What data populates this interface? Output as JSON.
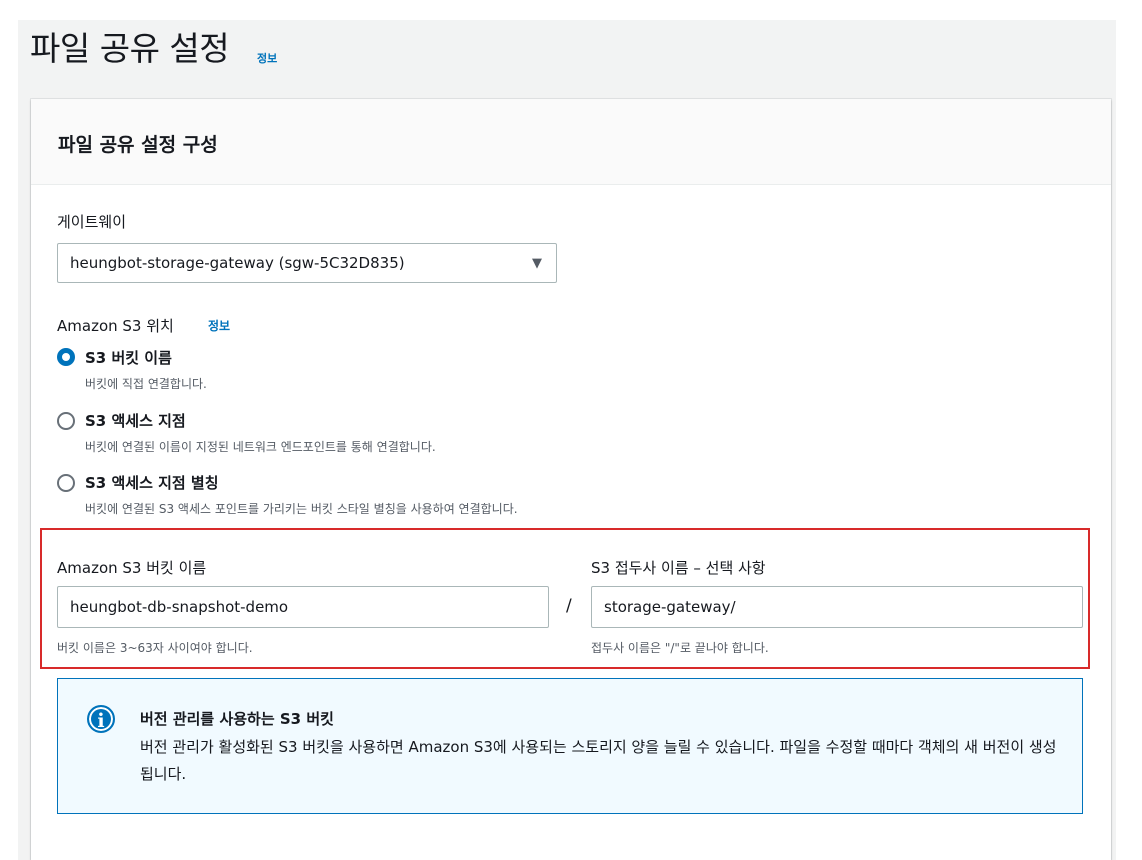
{
  "page": {
    "title": "파일 공유 설정",
    "info_link": "정보"
  },
  "panel": {
    "title": "파일 공유 설정 구성"
  },
  "gateway": {
    "label": "게이트웨이",
    "selected": "heungbot-storage-gateway (sgw-5C32D835)"
  },
  "s3_location": {
    "label": "Amazon S3 위치",
    "info_link": "정보",
    "options": [
      {
        "label": "S3 버킷 이름",
        "description": "버킷에 직접 연결합니다.",
        "checked": true
      },
      {
        "label": "S3 액세스 지점",
        "description": "버킷에 연결된 이름이 지정된 네트워크 엔드포인트를 통해 연결합니다.",
        "checked": false
      },
      {
        "label": "S3 액세스 지점 별칭",
        "description": "버킷에 연결된 S3 액세스 포인트를 가리키는 버킷 스타일 별칭을 사용하여 연결합니다.",
        "checked": false
      }
    ]
  },
  "bucket": {
    "label": "Amazon S3 버킷 이름",
    "value": "heungbot-db-snapshot-demo",
    "hint": "버킷 이름은 3~63자 사이여야 합니다.",
    "separator": "/"
  },
  "prefix": {
    "label": "S3 접두사 이름 – 선택 사항",
    "value": "storage-gateway/",
    "hint": "접두사 이름은 \"/\"로 끝나야 합니다."
  },
  "alert": {
    "icon": "info-icon",
    "title": "버전 관리를 사용하는 S3 버킷",
    "body": "버전 관리가 활성화된 S3 버킷을 사용하면 Amazon S3에 사용되는 스토리지 양을 늘릴 수 있습니다. 파일을 수정할 때마다 객체의 새 버전이 생성됩니다."
  },
  "colors": {
    "accent": "#0073bb",
    "highlight_border": "#d82a2a",
    "alert_bg": "#f1faff"
  }
}
